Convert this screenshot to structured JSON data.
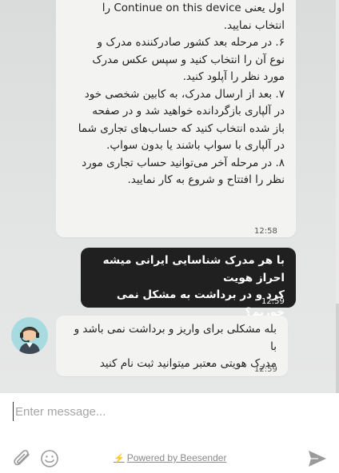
{
  "messages": {
    "agent_instructions": {
      "lines": [
        "اول یعنی Continue on this device را",
        "انتخاب نمایید.",
        "۶. در مرحله بعد کشور صادرکننده مدرک و",
        "نوع آن را انتخاب کنید و سپس عکس مدرک",
        "مورد نظر را آپلود کنید.",
        "۷. بعد از ارسال مدرک، به کابین شخصی خود",
        "در آلپاری بازگردانده خواهید شد و در صفحه",
        "باز شده انتخاب کنید که حساب‌های تجاری شما",
        "در آلپاری با سواپ باشند یا بدون سواپ.",
        "۸. در مرحله آخر می‌توانید حساب تجاری مورد",
        "نظر را افتتاح و شروع به کار نمایید."
      ],
      "time": "12:58"
    },
    "user_question": {
      "lines": [
        "با هر مدرک شناسایی ایرانی میشه احراز هویت",
        "کرد و در برداشت به مشکل نمی خوریم؟"
      ],
      "time": "12:59"
    },
    "agent_reply": {
      "lines": [
        "بله مشکلی برای واریز و برداشت نمی باشد و با",
        "مدرک هویتی معتبر میتوانید ثبت نام کنید"
      ],
      "time": "12:59"
    }
  },
  "composer": {
    "placeholder": "Enter message...",
    "attach_icon": "paperclip-icon",
    "emoji_icon": "smiley-icon",
    "send_icon": "send-icon",
    "powered_by": "Powered by Beesender"
  },
  "avatar": {
    "icon": "support-agent-headset-icon",
    "color": "#9fd6dc"
  }
}
